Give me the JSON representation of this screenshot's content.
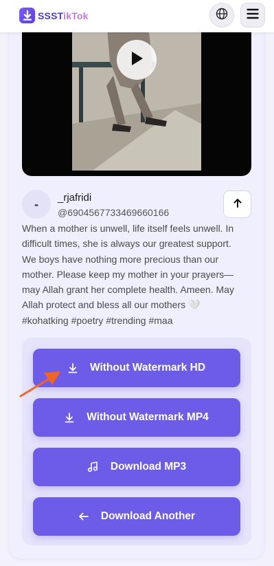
{
  "header": {
    "brand_part1": "SSST",
    "brand_part2": "ikTok",
    "icons": [
      "download-logo-icon",
      "globe-icon",
      "menu-icon"
    ]
  },
  "video": {
    "icons": [
      "play-icon"
    ]
  },
  "author": {
    "avatar_initial": "-",
    "name": "_rjafridi",
    "handle": "@6904567733469660166"
  },
  "caption": "When a mother is unwell, life itself feels unwell. In difficult times, she is always our greatest support. We boys have nothing more precious than our mother. Please keep my mother in your prayers—may Allah grant her complete health. Ameen. May Allah protect and bless all our mothers 🤍 #kohatking #poetry #trending #maa",
  "downloads": [
    {
      "label": "Without Watermark HD",
      "icon": "download-icon"
    },
    {
      "label": "Without Watermark MP4",
      "icon": "download-icon"
    },
    {
      "label": "Download MP3",
      "icon": "music-note-icon"
    },
    {
      "label": "Download Another",
      "icon": "arrow-left-icon"
    }
  ],
  "colors": {
    "accent": "#6c5ce7",
    "panel": "#e6e3fb",
    "card": "#f0effd",
    "annotation_arrow": "#f26522"
  }
}
